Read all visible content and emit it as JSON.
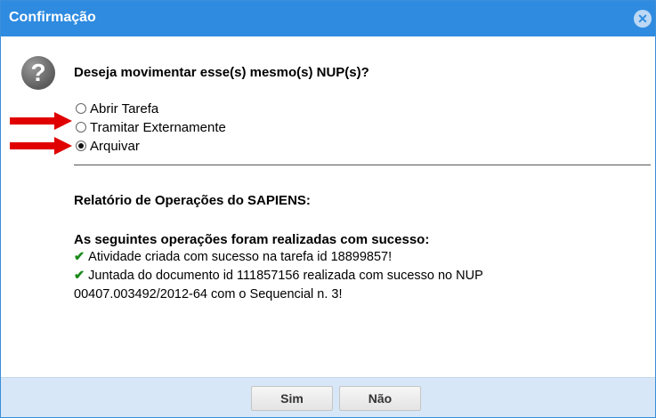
{
  "dialog": {
    "title": "Confirmação",
    "close_icon": "close-icon",
    "question": "Deseja movimentar esse(s) mesmo(s) NUP(s)?",
    "options": [
      {
        "label": "Abrir Tarefa",
        "checked": false
      },
      {
        "label": "Tramitar Externamente",
        "checked": false
      },
      {
        "label": "Arquivar",
        "checked": true
      }
    ],
    "report_title": "Relatório de Operações do SAPIENS:",
    "success_title": "As seguintes operações foram realizadas com sucesso:",
    "success_items": [
      "Atividade criada com sucesso na tarefa id 18899857!",
      "Juntada do documento id 111857156 realizada com sucesso no NUP",
      "00407.003492/2012-64 com o Sequencial n. 3!"
    ],
    "buttons": {
      "yes": "Sim",
      "no": "Não"
    }
  },
  "colors": {
    "titlebar": "#2f8be0",
    "footer": "#d7e7f7",
    "arrow": "#e00000",
    "check": "#1a8a1a"
  }
}
